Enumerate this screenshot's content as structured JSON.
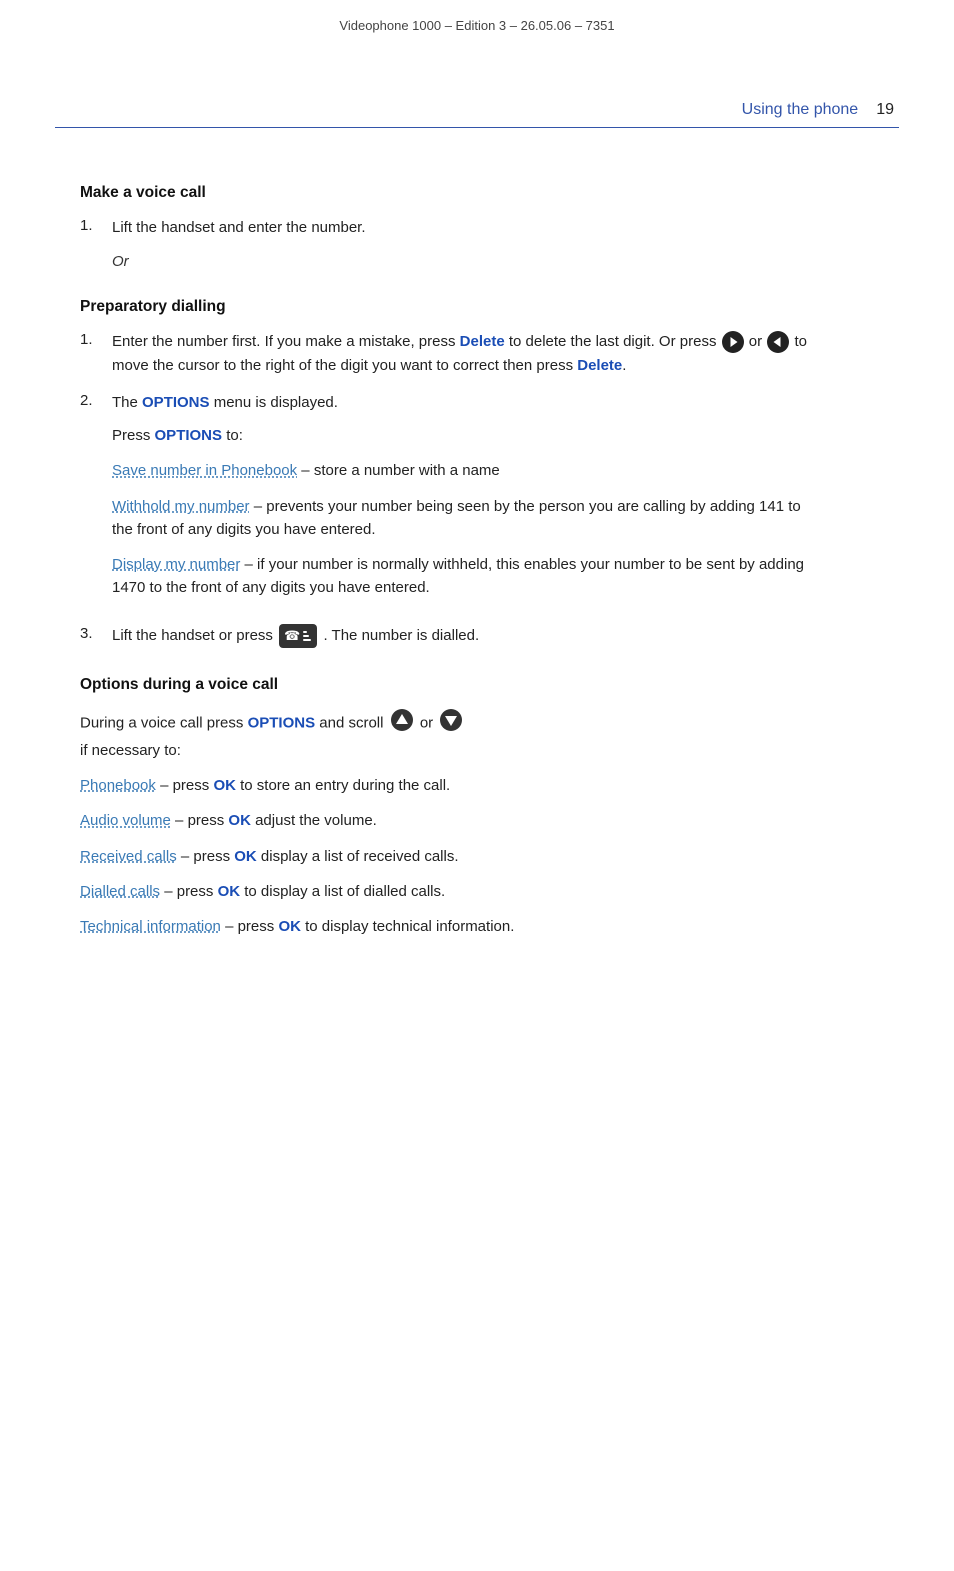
{
  "header": {
    "text": "Videophone 1000 – Edition 3 – 26.05.06 – 7351"
  },
  "top_bar": {
    "section_title": "Using the phone",
    "page_number": "19"
  },
  "make_voice_call": {
    "heading": "Make a voice call",
    "step1": "Lift the handset and enter the number.",
    "or_text": "Or"
  },
  "preparatory_dialling": {
    "heading": "Preparatory dialling",
    "step1_prefix": "Enter the number first. If you make a mistake, press ",
    "step1_delete": "Delete",
    "step1_mid": " to delete the last digit. Or press",
    "step1_suffix": "to move the cursor to the right of the digit you want to correct then press ",
    "step1_delete2": "Delete",
    "step1_end": ".",
    "step2_prefix": "The ",
    "step2_options": "OPTIONS",
    "step2_suffix": " menu is displayed.",
    "press_label": "Press ",
    "press_options": "OPTIONS",
    "press_to": " to:",
    "menu_items": [
      {
        "link_text": "Save number in Phonebook",
        "description": " – store a number with a name"
      },
      {
        "link_text": "Withhold my number",
        "description": " – prevents your number being seen by the person you are calling by adding 141 to the front of any digits you have entered."
      },
      {
        "link_text": "Display my number",
        "description": " – if your number is normally withheld, this enables your number to be sent by adding 1470 to the front of any digits you have entered."
      }
    ],
    "step3_prefix": "Lift the handset or press",
    "step3_suffix": ". The number is dialled."
  },
  "options_voice_call": {
    "heading": "Options during a voice call",
    "intro_prefix": "During a voice call press ",
    "intro_options": "OPTIONS",
    "intro_mid": " and scroll",
    "intro_or": "or",
    "intro_suffix": "if necessary to:",
    "menu_items": [
      {
        "link_text": "Phonebook",
        "prefix": " – press ",
        "bold": "OK",
        "suffix": " to store an entry during the call."
      },
      {
        "link_text": "Audio volume",
        "prefix": " – press ",
        "bold": "OK",
        "suffix": " adjust the volume."
      },
      {
        "link_text": "Received calls",
        "prefix": " – press ",
        "bold": "OK",
        "suffix": " display a list of received calls."
      },
      {
        "link_text": "Dialled calls",
        "prefix": " – press ",
        "bold": "OK",
        "suffix": " to display a list of dialled calls."
      },
      {
        "link_text": "Technical information",
        "prefix": " – press ",
        "bold": "OK",
        "suffix": " to display technical information."
      }
    ]
  }
}
